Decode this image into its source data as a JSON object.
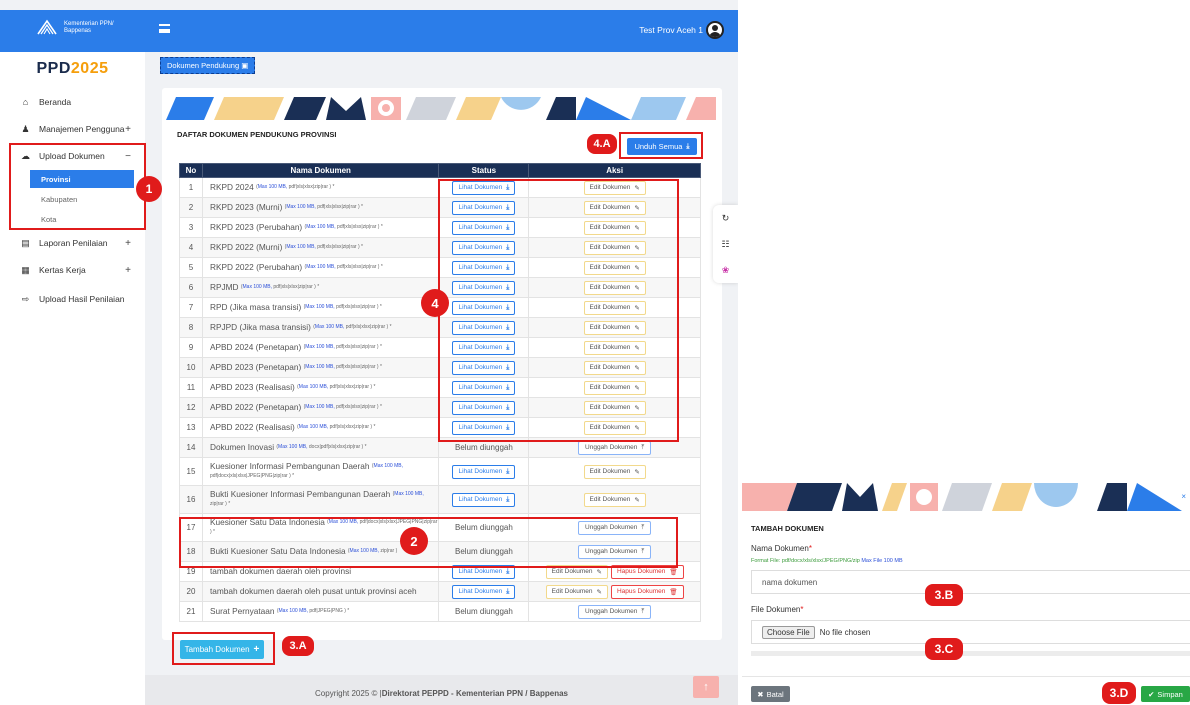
{
  "header": {
    "logo_text": "Kementerian PPN/\nBappenas",
    "user_name": "Test Prov Aceh 1"
  },
  "sidebar": {
    "brand_main": "PPD",
    "brand_year": "2025",
    "items": [
      {
        "label": "Beranda",
        "icon": "home-icon"
      },
      {
        "label": "Manajemen Pengguna",
        "icon": "users-icon",
        "toggle": "+"
      },
      {
        "label": "Upload Dokumen",
        "icon": "cloud-icon",
        "toggle": "−"
      },
      {
        "label": "Laporan Penilaian",
        "icon": "report-icon",
        "toggle": "+"
      },
      {
        "label": "Kertas Kerja",
        "icon": "worksheet-icon",
        "toggle": "+"
      },
      {
        "label": "Upload Hasil Penilaian",
        "icon": "upload-icon"
      }
    ],
    "sub_items": [
      "Provinsi",
      "Kabupaten",
      "Kota"
    ]
  },
  "tab": {
    "label": "Dokumen Pendukung"
  },
  "card": {
    "title": "DAFTAR DOKUMEN PENDUKUNG PROVINSI",
    "unduh_semua": "Unduh Semua",
    "columns": [
      "No",
      "Nama Dokumen",
      "Status",
      "Aksi"
    ]
  },
  "labels": {
    "lihat": "Lihat Dokumen",
    "edit": "Edit Dokumen",
    "unggah": "Unggah Dokumen",
    "hapus": "Hapus Dokumen",
    "belum": "Belum diunggah",
    "max": "Max 100 MB,"
  },
  "rows": [
    {
      "no": "1",
      "name": "RKPD 2024",
      "fmt": "pdf|xls|xlsx|zip|rar ) *",
      "status": "lihat",
      "aksi": "edit"
    },
    {
      "no": "2",
      "name": "RKPD 2023 (Murni)",
      "fmt": "pdf|xls|xlsx|zip|rar ) *",
      "status": "lihat",
      "aksi": "edit"
    },
    {
      "no": "3",
      "name": "RKPD 2023 (Perubahan)",
      "fmt": "pdf|xls|xlsx|zip|rar ) *",
      "status": "lihat",
      "aksi": "edit"
    },
    {
      "no": "4",
      "name": "RKPD 2022 (Murni)",
      "fmt": "pdf|xls|xlsx|zip|rar ) *",
      "status": "lihat",
      "aksi": "edit"
    },
    {
      "no": "5",
      "name": "RKPD 2022 (Perubahan)",
      "fmt": "pdf|xls|xlsx|zip|rar ) *",
      "status": "lihat",
      "aksi": "edit"
    },
    {
      "no": "6",
      "name": "RPJMD",
      "fmt": "pdf|xls|xlsx|zip|rar ) *",
      "status": "lihat",
      "aksi": "edit"
    },
    {
      "no": "7",
      "name": "RPD (Jika masa transisi)",
      "fmt": "pdf|xls|xlsx|zip|rar ) *",
      "status": "lihat",
      "aksi": "edit"
    },
    {
      "no": "8",
      "name": "RPJPD (Jika masa transisi)",
      "fmt": "pdf|xls|xlsx|zip|rar ) *",
      "status": "lihat",
      "aksi": "edit"
    },
    {
      "no": "9",
      "name": "APBD 2024 (Penetapan)",
      "fmt": "pdf|xls|xlsx|zip|rar ) *",
      "status": "lihat",
      "aksi": "edit"
    },
    {
      "no": "10",
      "name": "APBD 2023 (Penetapan)",
      "fmt": "pdf|xls|xlsx|zip|rar ) *",
      "status": "lihat",
      "aksi": "edit"
    },
    {
      "no": "11",
      "name": "APBD 2023 (Realisasi)",
      "fmt": "pdf|xls|xlsx|zip|rar ) *",
      "status": "lihat",
      "aksi": "edit"
    },
    {
      "no": "12",
      "name": "APBD 2022 (Penetapan)",
      "fmt": "pdf|xls|xlsx|zip|rar ) *",
      "status": "lihat",
      "aksi": "edit"
    },
    {
      "no": "13",
      "name": "APBD 2022 (Realisasi)",
      "fmt": "pdf|xls|xlsx|zip|rar ) *",
      "status": "lihat",
      "aksi": "edit"
    },
    {
      "no": "14",
      "name": "Dokumen Inovasi",
      "fmt": "docx|pdf|xls|xlsx|zip|rar ) *",
      "status": "belum",
      "aksi": "unggah"
    },
    {
      "no": "15",
      "name": "Kuesioner Informasi Pembangunan Daerah",
      "fmt": "pdf|docx|xls|xlsx|JPEG|PNG|zip|rar ) *",
      "status": "lihat",
      "aksi": "edit",
      "tall": true
    },
    {
      "no": "16",
      "name": "Bukti Kuesioner Informasi Pembangunan Daerah",
      "fmt": "zip|rar ) *",
      "status": "lihat",
      "aksi": "edit",
      "tall": true
    },
    {
      "no": "17",
      "name": "Kuesioner Satu Data Indonesia",
      "fmt": "pdf|docx|xls|xlsx|JPEG|PNG|zip|rar ) *",
      "status": "belum",
      "aksi": "unggah",
      "tall": true
    },
    {
      "no": "18",
      "name": "Bukti Kuesioner Satu Data Indonesia",
      "fmt": "zip|rar )",
      "status": "belum",
      "aksi": "unggah"
    },
    {
      "no": "19",
      "name": "tambah dokumen daerah oleh provinsi",
      "fmt": "",
      "status": "lihat",
      "aksi": "edit-hapus"
    },
    {
      "no": "20",
      "name": "tambah dokumen daerah oleh pusat untuk provinsi aceh",
      "fmt": "",
      "status": "lihat",
      "aksi": "edit-hapus"
    },
    {
      "no": "21",
      "name": "Surat Pernyataan",
      "fmt": "pdf|JPEG|PNG ) *",
      "status": "belum",
      "aksi": "unggah"
    }
  ],
  "tambah": "Tambah Dokumen",
  "footer": {
    "prefix": "Copyright 2025 © |",
    "org": "Direktorat PEPPD - Kementerian PPN / Bappenas"
  },
  "annotations": {
    "a1": "1",
    "a2": "2",
    "a3a": "3.A",
    "a3b": "3.B",
    "a3c": "3.C",
    "a3d": "3.D",
    "a4": "4",
    "a4a": "4.A"
  },
  "modal": {
    "close": "×",
    "title": "TAMBAH DOKUMEN",
    "nama_label": "Nama Dokumen",
    "req": "*",
    "format_prefix": "Format File: pdf/docx/xls/xlsx/JPEG/PNG/zip",
    "format_max": "Max File 100 MB",
    "nama_value": "nama dokumen",
    "file_label": "File Dokumen",
    "choose_file": "Choose File",
    "no_file": "No file chosen",
    "batal": "Batal",
    "simpan": "Simpan"
  },
  "colors": {
    "primary": "#2b7de9",
    "navy": "#1a2f55",
    "danger": "#e01b1b",
    "success": "#28a745",
    "info": "#34b5e8"
  }
}
